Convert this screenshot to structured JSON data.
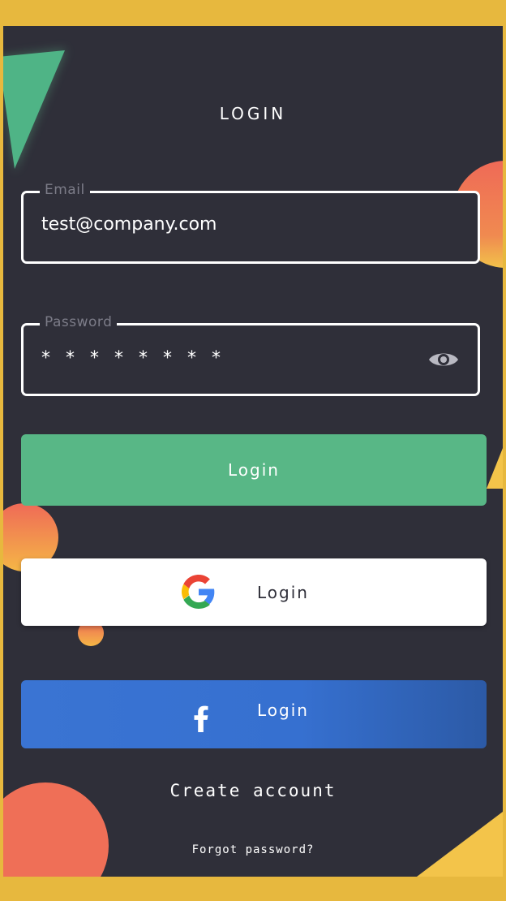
{
  "header": {
    "title": "LOGIN"
  },
  "email": {
    "label": "Email",
    "value": "test@company.com"
  },
  "password": {
    "label": "Password",
    "value": "********",
    "toggle_icon": "eye-icon"
  },
  "buttons": {
    "login_label": "Login",
    "google_label": "Login",
    "google_icon": "google-icon",
    "facebook_label": "Login",
    "facebook_icon": "facebook-icon"
  },
  "links": {
    "create_account": "Create account",
    "forgot_password": "Forgot password?"
  },
  "colors": {
    "frame": "#e7b83e",
    "background": "#2f2f39",
    "primary_green": "#58b786",
    "facebook_blue": "#3a74d3",
    "decor_coral": "#ee6e58",
    "decor_yellow": "#f3c44a"
  }
}
